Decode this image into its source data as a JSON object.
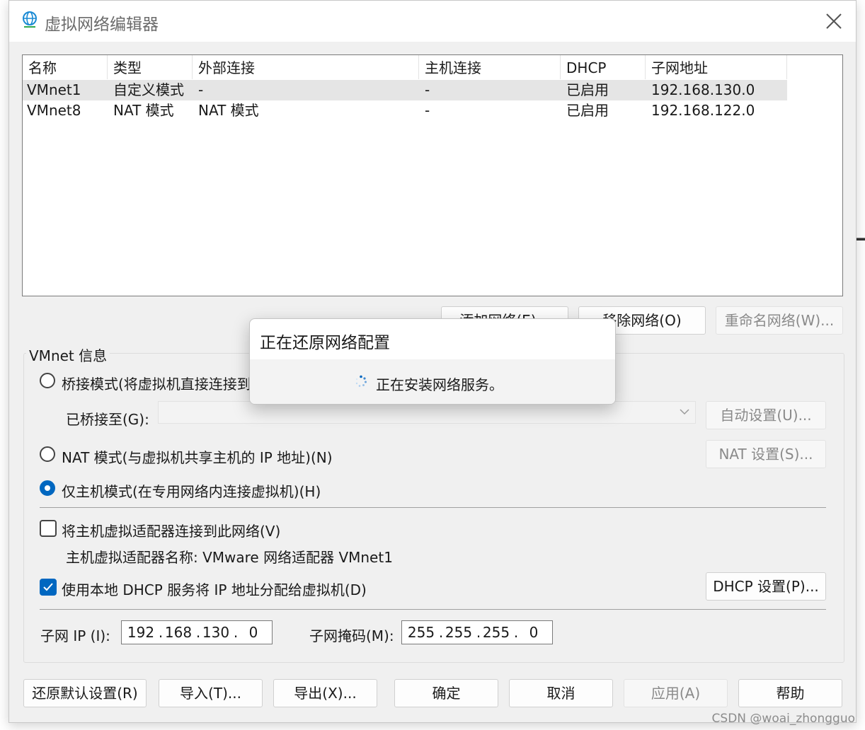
{
  "window": {
    "title": "虚拟网络编辑器"
  },
  "table": {
    "columns": [
      "名称",
      "类型",
      "外部连接",
      "主机连接",
      "DHCP",
      "子网地址"
    ],
    "rows": [
      [
        "VMnet1",
        "自定义模式",
        "-",
        "-",
        "已启用",
        "192.168.130.0"
      ],
      [
        "VMnet8",
        "NAT 模式",
        "NAT 模式",
        "-",
        "已启用",
        "192.168.122.0"
      ]
    ]
  },
  "network_buttons": {
    "add": "添加网络(E)...",
    "remove": "移除网络(O)",
    "rename": "重命名网络(W)..."
  },
  "vmnet_info": {
    "group_label": "VMnet 信息",
    "bridged_label": "桥接模式(将虚拟机直接连接到",
    "bridged_to_label": "已桥接至(G):",
    "auto_settings": "自动设置(U)...",
    "nat_label": "NAT 模式(与虚拟机共享主机的 IP 地址)(N)",
    "nat_settings": "NAT 设置(S)...",
    "hostonly_label": "仅主机模式(在专用网络内连接虚拟机)(H)",
    "connect_adapter_label": "将主机虚拟适配器连接到此网络(V)",
    "adapter_name_text": "主机虚拟适配器名称: VMware 网络适配器 VMnet1",
    "dhcp_label": "使用本地 DHCP 服务将 IP 地址分配给虚拟机(D)",
    "dhcp_settings": "DHCP 设置(P)...",
    "subnet_ip_label": "子网 IP (I):",
    "subnet_ip": [
      "192",
      "168",
      "130",
      "0"
    ],
    "subnet_mask_label": "子网掩码(M):",
    "subnet_mask": [
      "255",
      "255",
      "255",
      "0"
    ]
  },
  "bottom_buttons": {
    "restore": "还原默认设置(R)",
    "import": "导入(T)...",
    "export": "导出(X)...",
    "ok": "确定",
    "cancel": "取消",
    "apply": "应用(A)",
    "help": "帮助"
  },
  "progress_dialog": {
    "title": "正在还原网络配置",
    "message": "正在安装网络服务。"
  },
  "watermark": "CSDN @woai_zhongguo",
  "colors": {
    "accent": "#0067c0",
    "window_bg": "#f0f0f0",
    "disabled_text": "#8a8a8a"
  }
}
